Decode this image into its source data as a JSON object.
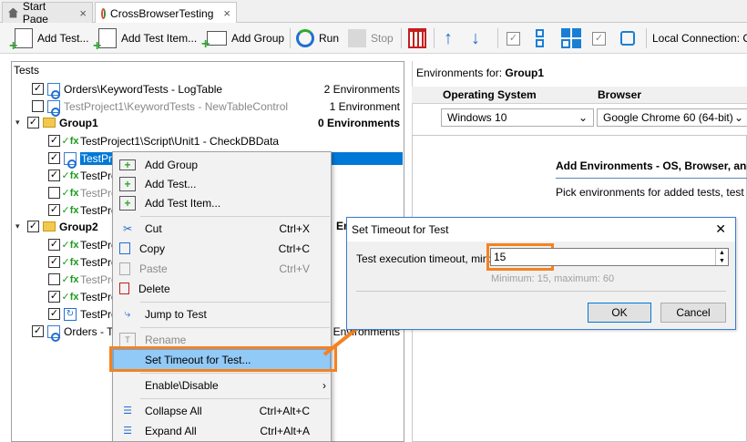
{
  "tabs": [
    {
      "label": "Start Page",
      "close": "×"
    },
    {
      "label": "CrossBrowserTesting",
      "close": "×"
    }
  ],
  "toolbar": {
    "add_test": "Add Test...",
    "add_test_items": "Add Test Item...",
    "add_group": "Add Group",
    "run": "Run",
    "stop": "Stop",
    "local_connection": "Local Connection: C"
  },
  "tree": {
    "header": "Tests",
    "rows": [
      {
        "label": "Orders\\KeywordTests - LogTable",
        "envs": "2 Environments"
      },
      {
        "label": "TestProject1\\KeywordTests - NewTableControl",
        "envs": "1 Environment"
      },
      {
        "label": "Group1",
        "envs": "0 Environments"
      },
      {
        "label": "TestProject1\\Script\\Unit1 - CheckDBData"
      },
      {
        "label": "TestProj"
      },
      {
        "label": "TestProj"
      },
      {
        "label": "TestProj"
      },
      {
        "label": "TestProj"
      },
      {
        "label": "Group2",
        "envs": "Env"
      },
      {
        "label": "TestProj"
      },
      {
        "label": "TestProj"
      },
      {
        "label": "TestProj"
      },
      {
        "label": "TestProj"
      },
      {
        "label": "TestProj"
      },
      {
        "label": "Orders - Te",
        "envs": "3 Environments"
      }
    ]
  },
  "right": {
    "env_for_label": "Environments for: ",
    "env_for_group": "Group1",
    "col_os": "Operating System",
    "col_browser": "Browser",
    "os_value": "Windows 10",
    "browser_value": "Google Chrome 60 (64-bit)",
    "add_env_title": "Add Environments - OS, Browser, and",
    "add_env_desc": "Pick environments for added tests, test item"
  },
  "context_menu": {
    "add_group": "Add Group",
    "add_test": "Add Test...",
    "add_test_item": "Add Test Item...",
    "cut": "Cut",
    "cut_sc": "Ctrl+X",
    "copy": "Copy",
    "copy_sc": "Ctrl+C",
    "paste": "Paste",
    "paste_sc": "Ctrl+V",
    "delete": "Delete",
    "jump_to_test": "Jump to Test",
    "rename": "Rename",
    "set_timeout": "Set Timeout for Test...",
    "enable_disable": "Enable\\Disable",
    "collapse_all": "Collapse All",
    "collapse_all_sc": "Ctrl+Alt+C",
    "expand_all": "Expand All",
    "expand_all_sc": "Ctrl+Alt+A"
  },
  "dialog": {
    "title": "Set Timeout for Test",
    "close": "✕",
    "field_label": "Test execution timeout, min:",
    "field_value": "15",
    "hint": "Minimum: 15, maximum: 60",
    "ok": "OK",
    "cancel": "Cancel"
  },
  "colors": {
    "selection": "#0078d7",
    "highlight": "#91c9f7",
    "callout": "#f58220"
  }
}
